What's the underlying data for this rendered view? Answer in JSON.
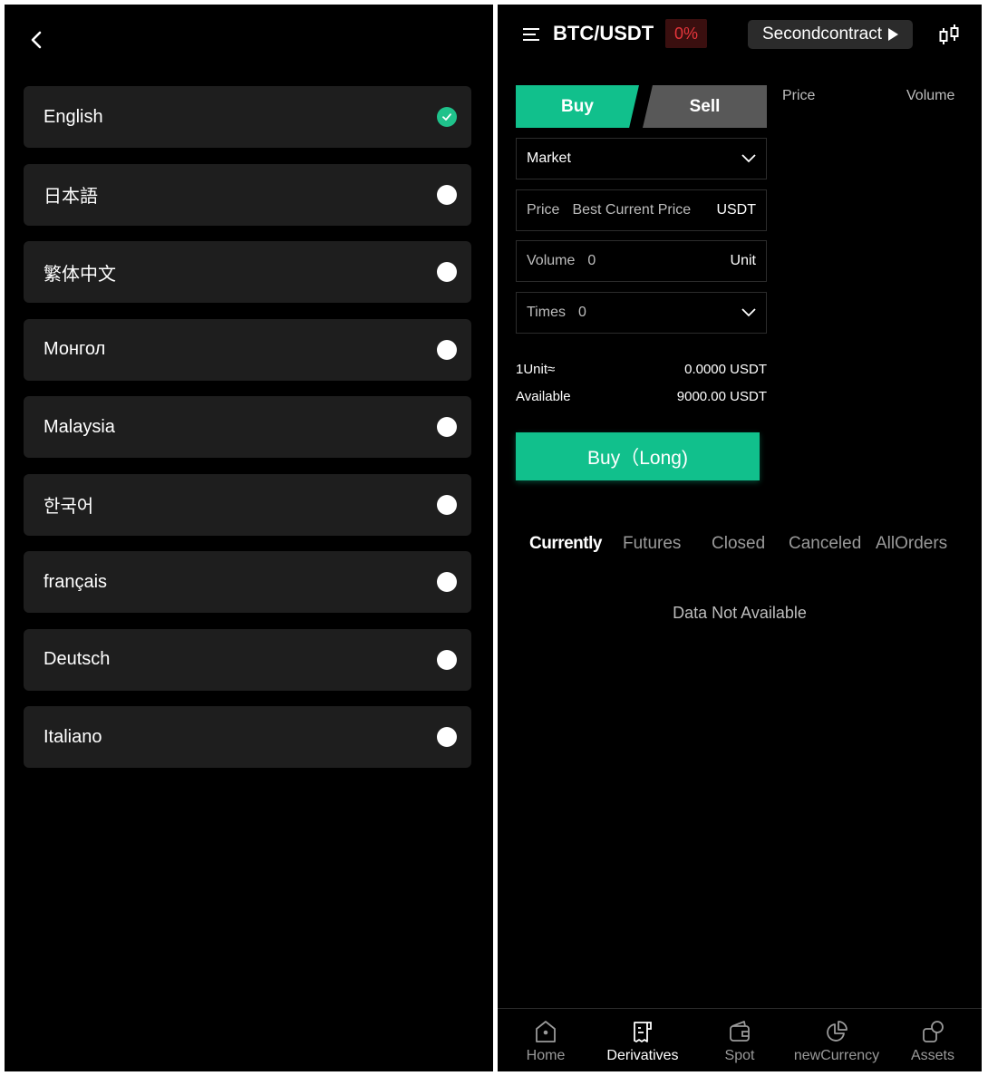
{
  "languages": {
    "items": [
      {
        "label": "English",
        "selected": true
      },
      {
        "label": "日本語",
        "selected": false
      },
      {
        "label": "繁体中文",
        "selected": false
      },
      {
        "label": "Монгол",
        "selected": false
      },
      {
        "label": "Malaysia",
        "selected": false
      },
      {
        "label": "한국어",
        "selected": false
      },
      {
        "label": "français",
        "selected": false
      },
      {
        "label": "Deutsch",
        "selected": false
      },
      {
        "label": "Italiano",
        "selected": false
      }
    ]
  },
  "header": {
    "pair": "BTC/USDT",
    "change": "0%",
    "contract_label": "Secondcontract"
  },
  "trade": {
    "buy_tab": "Buy",
    "sell_tab": "Sell",
    "orderbook_price": "Price",
    "orderbook_volume": "Volume",
    "order_type": "Market",
    "price_label": "Price",
    "price_value": "Best Current Price",
    "price_unit": "USDT",
    "volume_label": "Volume",
    "volume_value": "0",
    "volume_unit": "Unit",
    "times_label": "Times",
    "times_value": "0",
    "unit_label": "1Unit≈",
    "unit_value": "0.0000 USDT",
    "available_label": "Available",
    "available_value": "9000.00 USDT",
    "submit_label": "Buy（Long)"
  },
  "orders": {
    "tabs": [
      "Currently",
      "Futures",
      "Closed",
      "Canceled",
      "AllOrders"
    ],
    "active_tab": "Currently",
    "empty_message": "Data Not Available"
  },
  "nav": {
    "items": [
      "Home",
      "Derivatives",
      "Spot",
      "newCurrency",
      "Assets"
    ],
    "active": "Derivatives"
  },
  "colors": {
    "accent_green": "#11c08c",
    "check_green": "#1fc28b",
    "loss_red": "#e5353b",
    "card_bg": "#1e1e1e"
  }
}
